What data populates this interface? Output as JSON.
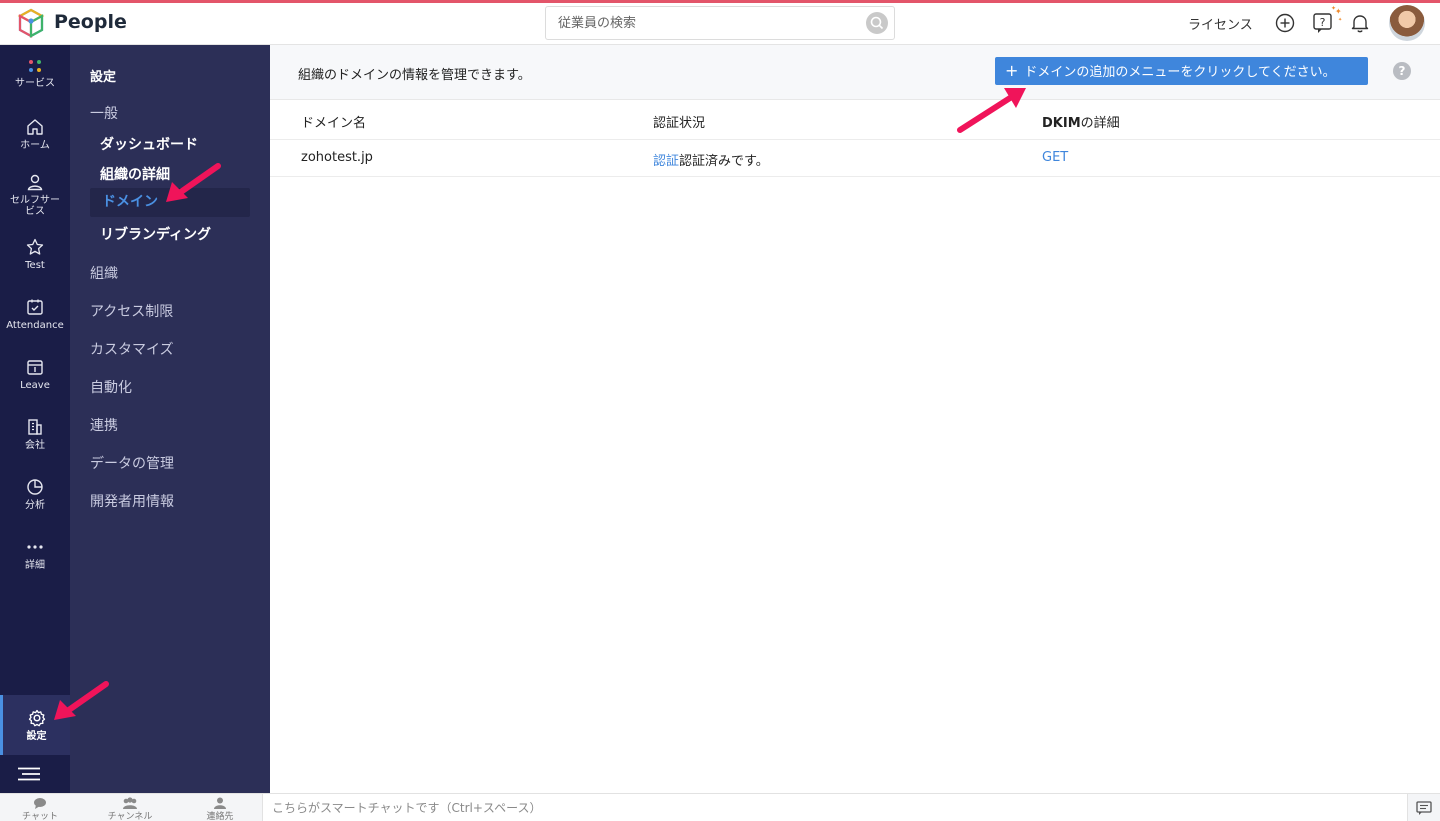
{
  "app": {
    "name": "People"
  },
  "header": {
    "search_placeholder": "従業員の検索",
    "license_label": "ライセンス"
  },
  "rail": {
    "items": [
      {
        "label": "サービス",
        "icon": "apps-grid-icon"
      },
      {
        "label": "ホーム",
        "icon": "home-icon"
      },
      {
        "label": "セルフサー\nビス",
        "icon": "user-icon"
      },
      {
        "label": "Test",
        "icon": "star-icon"
      },
      {
        "label": "Attendance",
        "icon": "calendar-check-icon"
      },
      {
        "label": "Leave",
        "icon": "calendar-icon"
      },
      {
        "label": "会社",
        "icon": "building-icon"
      },
      {
        "label": "分析",
        "icon": "pie-chart-icon"
      },
      {
        "label": "詳細",
        "icon": "more-icon"
      },
      {
        "label": "設定",
        "icon": "gear-icon"
      }
    ]
  },
  "settings_nav": {
    "title": "設定",
    "general": "一般",
    "general_items": [
      "ダッシュボード",
      "組織の詳細",
      "ドメイン",
      "リブランディング"
    ],
    "groups": [
      "組織",
      "アクセス制限",
      "カスタマイズ",
      "自動化",
      "連携",
      "データの管理",
      "開発者用情報"
    ]
  },
  "main": {
    "description": "組織のドメインの情報を管理できます。",
    "add_button_label": "ドメインの追加のメニューをクリックしてください。",
    "help_label": "?",
    "columns": {
      "domain": "ドメイン名",
      "status": "認証状況",
      "dkim_prefix": "DKIM",
      "dkim_suffix": "の詳細"
    },
    "rows": [
      {
        "domain": "zohotest.jp",
        "status_link": "認証",
        "status_text": "認証済みです。",
        "dkim": "GET"
      }
    ]
  },
  "bottom": {
    "chat": "チャット",
    "channel": "チャンネル",
    "contacts": "連絡先",
    "chat_placeholder": "こちらがスマートチャットです（Ctrl+スペース）"
  },
  "colors": {
    "accent": "#3f86dc",
    "rail_bg": "#1a1d47",
    "nav_bg": "#2c2f57",
    "top_line": "#e3556a",
    "annotation": "#f0145a"
  }
}
